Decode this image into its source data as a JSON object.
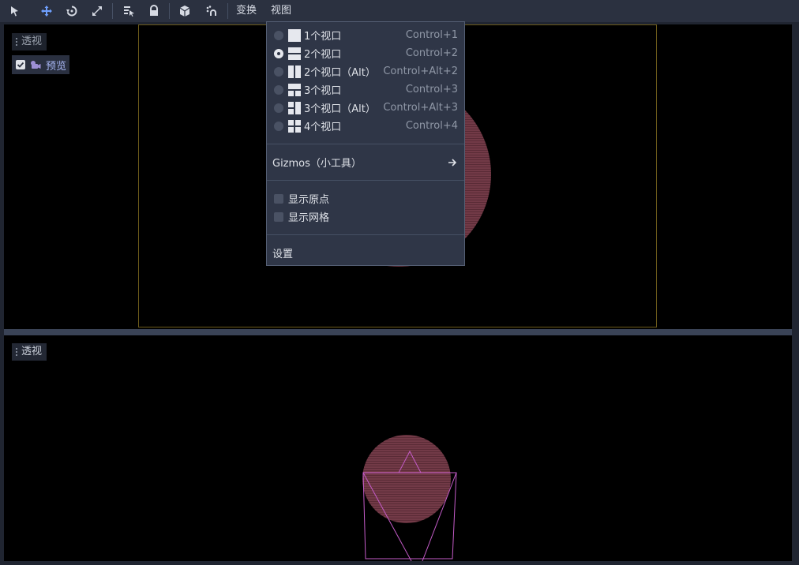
{
  "toolbar": {
    "tools": [
      {
        "name": "select-tool-icon"
      },
      {
        "name": "move-tool-icon"
      },
      {
        "name": "rotate-tool-icon"
      },
      {
        "name": "scale-tool-icon"
      },
      {
        "name": "list-select-icon"
      },
      {
        "name": "lock-icon"
      },
      {
        "name": "group-icon"
      },
      {
        "name": "snap-icon"
      }
    ],
    "menus": {
      "transform": "变换",
      "view": "视图"
    }
  },
  "viewports": {
    "top": {
      "label": "透视",
      "preview_label": "预览",
      "preview_checked": true
    },
    "bottom": {
      "label": "透视"
    }
  },
  "view_menu": {
    "layouts": [
      {
        "label": "1个视口",
        "shortcut": "Control+1",
        "selected": false
      },
      {
        "label": "2个视口",
        "shortcut": "Control+2",
        "selected": true
      },
      {
        "label": "2个视口（Alt）",
        "shortcut": "Control+Alt+2",
        "selected": false
      },
      {
        "label": "3个视口",
        "shortcut": "Control+3",
        "selected": false
      },
      {
        "label": "3个视口（Alt）",
        "shortcut": "Control+Alt+3",
        "selected": false
      },
      {
        "label": "4个视口",
        "shortcut": "Control+4",
        "selected": false
      }
    ],
    "gizmos_label": "Gizmos（小工具）",
    "show_origin_label": "显示原点",
    "show_grid_label": "显示网格",
    "settings_label": "设置"
  },
  "colors": {
    "accent": "#6fa0ff",
    "preview_text": "#a9b7f5",
    "sphere": "#7a3a4a",
    "camera_gizmo": "#c45bc8"
  }
}
